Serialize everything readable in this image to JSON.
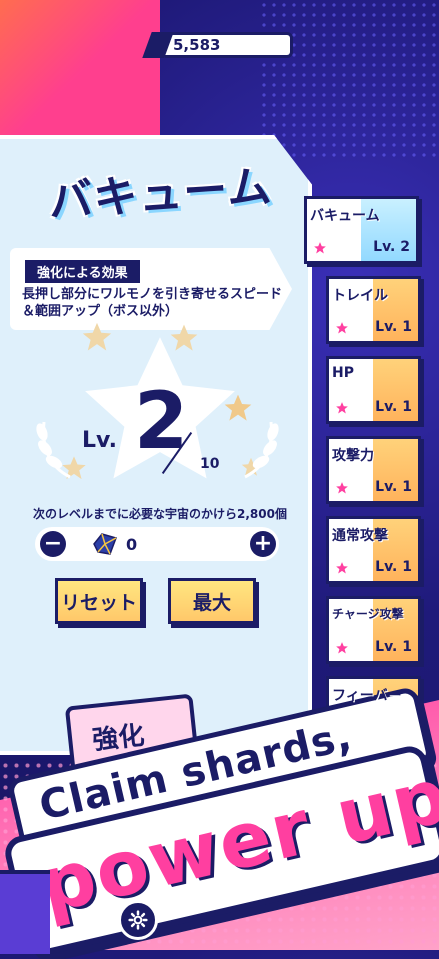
{
  "top_counter": {
    "value": "5,583"
  },
  "skill": {
    "title": "バキューム",
    "effect_label": "強化による効果",
    "effect_text": "長押し部分にワルモノを引き寄せるスピード＆範囲アップ（ボス以外）",
    "level_label": "Lv.",
    "level": "2",
    "max_level": "10",
    "next_level_text": "次のレベルまでに必要な宇宙のかけら2,800個",
    "shard_count": "0",
    "minus": "−",
    "plus": "+",
    "reset_label": "リセット",
    "max_label": "最大"
  },
  "tabs": [
    {
      "name": "バキューム",
      "level": "Lv. 2",
      "active": true
    },
    {
      "name": "トレイル",
      "level": "Lv. 1"
    },
    {
      "name": "HP",
      "level": "Lv. 1"
    },
    {
      "name": "攻撃力",
      "level": "Lv. 1"
    },
    {
      "name": "通常攻撃",
      "level": "Lv. 1"
    },
    {
      "name": "チャージ攻撃",
      "level": "Lv. 1"
    },
    {
      "name": "フィーバー",
      "level": ""
    }
  ],
  "promo": {
    "card_text": "強化",
    "line1": "Claim shards,",
    "line2": "power up!!"
  },
  "colors": {
    "navy": "#1b1c66",
    "pink": "#ff3fa0",
    "star": "#f5b400",
    "tab_stripe": "#ffc86a"
  },
  "icons": {
    "settings": "gear-icon",
    "shard": "shard-icon",
    "star": "star-icon"
  }
}
